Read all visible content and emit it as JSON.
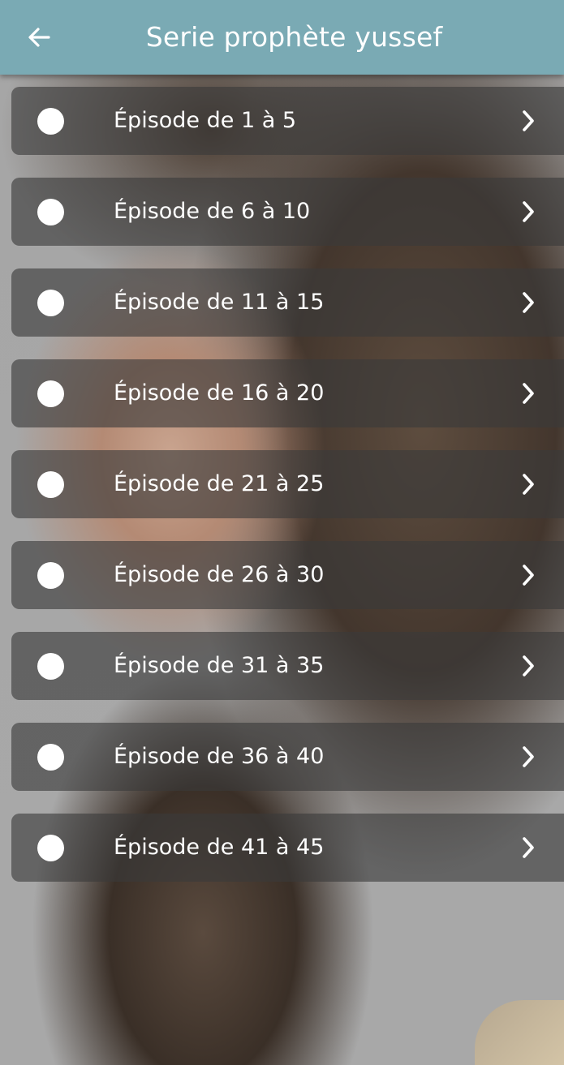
{
  "header": {
    "title": "Serie prophète yussef",
    "back_icon": "arrow-left-icon",
    "background_color": "#7aaab4"
  },
  "episodes": [
    {
      "label": "Épisode de 1 à 5"
    },
    {
      "label": "Épisode de 6 à 10"
    },
    {
      "label": "Épisode de 11 à 15"
    },
    {
      "label": "Épisode de 16 à 20"
    },
    {
      "label": "Épisode de 21 à 25"
    },
    {
      "label": "Épisode de 26 à 30"
    },
    {
      "label": "Épisode de 31 à 35"
    },
    {
      "label": "Épisode de 36 à 40"
    },
    {
      "label": "Épisode de 41 à 45"
    }
  ],
  "icons": {
    "radio": "radio-icon",
    "chevron": "chevron-right-icon"
  }
}
